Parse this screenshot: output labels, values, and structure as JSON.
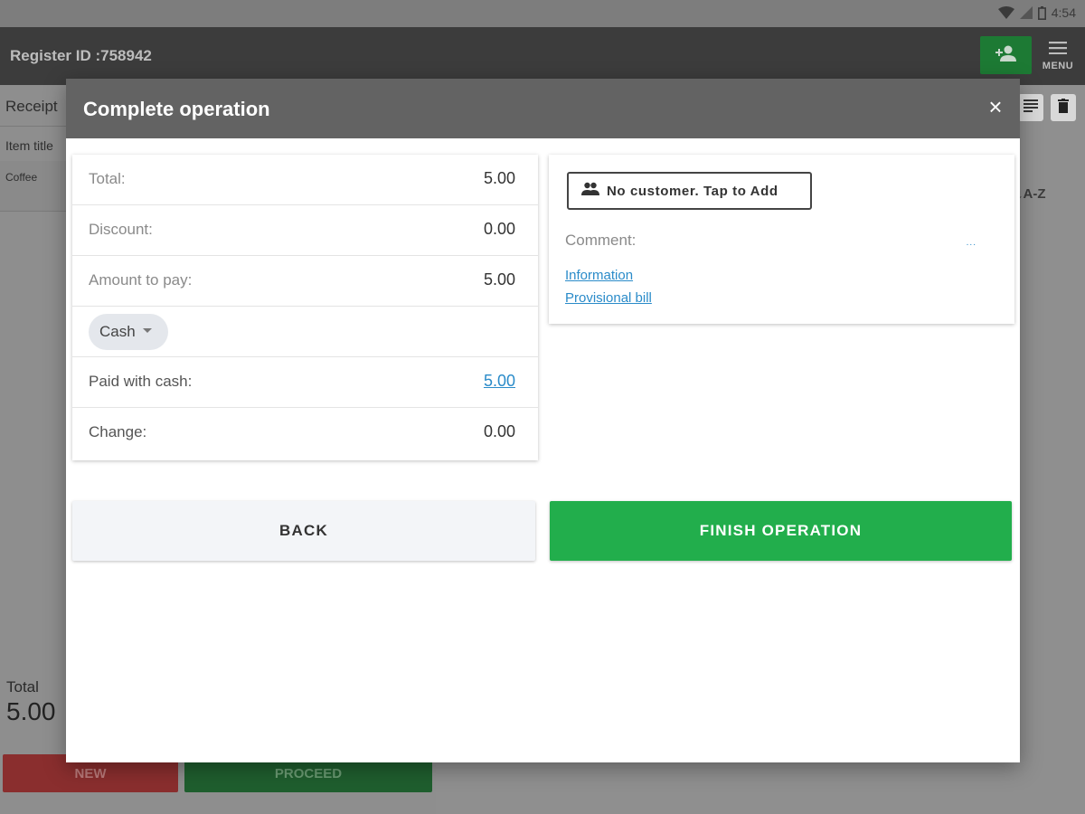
{
  "status_bar": {
    "time": "4:54"
  },
  "app_header": {
    "register_id": "Register ID :758942",
    "menu_label": "MENU"
  },
  "receipt": {
    "tab_label": "Receipt",
    "column_header": "Item title",
    "items": [
      {
        "name": "Coffee"
      }
    ],
    "total_label": "Total",
    "total_value": "5.00",
    "new_button": "NEW",
    "proceed_button": "PROCEED"
  },
  "sort_label": "A-Z",
  "dialog": {
    "title": "Complete operation",
    "summary": {
      "total_label": "Total:",
      "total_value": "5.00",
      "discount_label": "Discount:",
      "discount_value": "0.00",
      "amount_label": "Amount to pay:",
      "amount_value": "5.00",
      "payment_method": "Cash",
      "paid_label": "Paid with cash:",
      "paid_value": "5.00",
      "change_label": "Change:",
      "change_value": "0.00"
    },
    "info": {
      "customer_button": "No customer. Tap to Add",
      "comment_label": "Comment:",
      "comment_ellipsis": "...",
      "links": [
        "Information",
        "Provisional bill"
      ]
    },
    "back_button": "BACK",
    "finish_button": "FINISH OPERATION"
  },
  "colors": {
    "finish": "#22ae4c",
    "link": "#2a8bc9",
    "header": "#636363"
  }
}
